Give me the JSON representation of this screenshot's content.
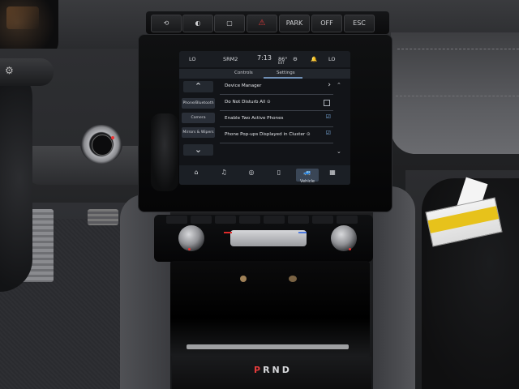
{
  "screen": {
    "status": {
      "left": "LO",
      "mid": "SRM2",
      "time": "7:13",
      "temp": "86°",
      "ext": "EXT",
      "right": "LO"
    },
    "tabs": [
      "Controls",
      "Settings"
    ],
    "side_buttons": [
      "Phone/Bluetooth",
      "Camera",
      "Mirrors & Wipers"
    ],
    "rows": [
      {
        "label": "Device Manager",
        "control": "chevron"
      },
      {
        "label": "Do Not Disturb All ⊙",
        "control": "box"
      },
      {
        "label": "Enable Two Active Phones",
        "control": "check"
      },
      {
        "label": "Phone Pop-ups Displayed in Cluster ⊙",
        "control": "check"
      }
    ],
    "nav_active_label": "Vehicle"
  },
  "switches": [
    "⟲",
    "◐",
    "▢",
    "⚠",
    "PARK",
    "OFF",
    "ESC"
  ],
  "gear": {
    "p": "P",
    "rest": "RND"
  },
  "colors": {
    "hazard": "#e03a3a",
    "park": "#e43b3b",
    "accent": "#6f8fb5",
    "sticker": "#e7c21b"
  }
}
